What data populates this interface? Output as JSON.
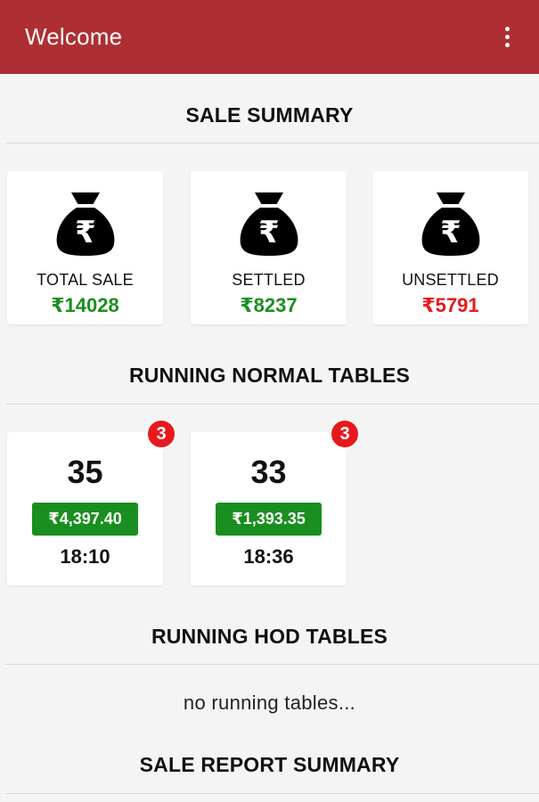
{
  "appbar": {
    "title": "Welcome",
    "menu_icon": "more-vert-icon"
  },
  "colors": {
    "appbar": "#ad2f33",
    "positive": "#1a8f1f",
    "negative": "#e8191c"
  },
  "sale_summary": {
    "heading": "SALE SUMMARY",
    "cards": [
      {
        "icon": "money-bag-rupee-icon",
        "label": "TOTAL SALE",
        "amount": "₹14028"
      },
      {
        "icon": "money-bag-rupee-icon",
        "label": "SETTLED",
        "amount": "₹8237"
      },
      {
        "icon": "money-bag-rupee-icon",
        "label": "UNSETTLED",
        "amount": "₹5791"
      }
    ]
  },
  "running_normal_tables": {
    "heading": "RUNNING NORMAL TABLES",
    "tables": [
      {
        "number": "35",
        "amount": "₹4,397.40",
        "time": "18:10",
        "badge": "3"
      },
      {
        "number": "33",
        "amount": "₹1,393.35",
        "time": "18:36",
        "badge": "3"
      }
    ]
  },
  "running_hod_tables": {
    "heading": "RUNNING HOD TABLES",
    "empty_message": "no running tables..."
  },
  "sale_report_summary": {
    "heading": "SALE REPORT SUMMARY"
  }
}
